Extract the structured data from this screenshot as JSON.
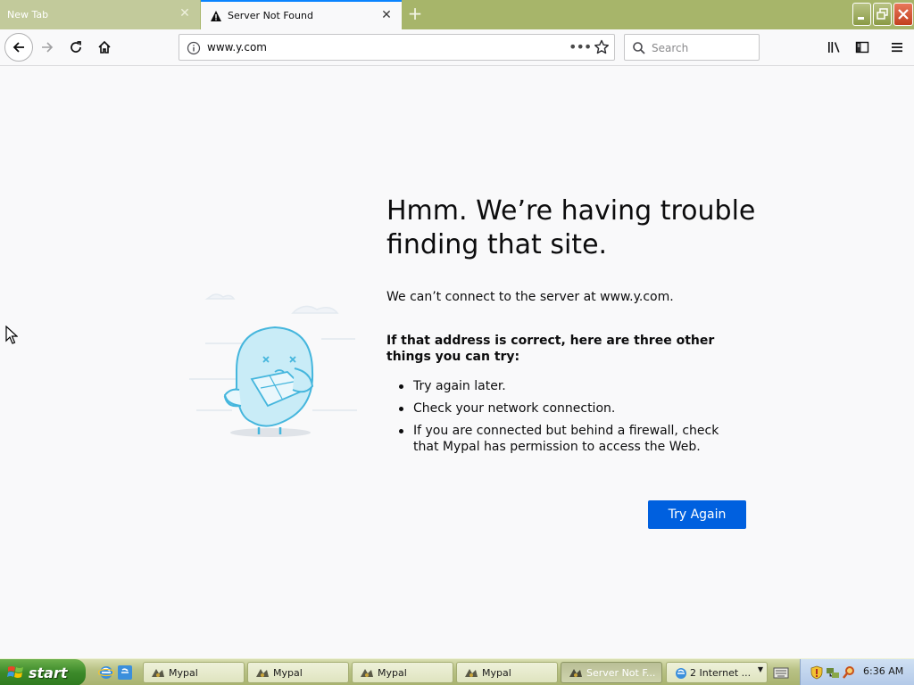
{
  "tabs": [
    {
      "title": "New Tab",
      "active": false
    },
    {
      "title": "Server Not Found",
      "active": true
    }
  ],
  "navbar": {
    "url": "www.y.com",
    "search_placeholder": "Search",
    "page_actions_label": "•••"
  },
  "error": {
    "title": "Hmm. We’re having trouble finding that site.",
    "description": "We can’t connect to the server at www.y.com.",
    "suggestions_heading": "If that address is correct, here are three other things you can try:",
    "suggestions": [
      "Try again later.",
      "Check your network connection.",
      "If you are connected but behind a firewall, check that Mypal has permission to access the Web."
    ],
    "button": "Try Again",
    "accent": "#0060df"
  },
  "taskbar": {
    "start_label": "start",
    "buttons": [
      {
        "label": "Mypal",
        "icon": "mypal-icon"
      },
      {
        "label": "Mypal",
        "icon": "mypal-icon"
      },
      {
        "label": "Mypal",
        "icon": "mypal-icon"
      },
      {
        "label": "Mypal",
        "icon": "mypal-icon"
      },
      {
        "label": "Server Not F...",
        "icon": "mypal-icon",
        "active": true
      },
      {
        "label": "2 Internet ...",
        "icon": "ie-icon"
      }
    ],
    "clock": "6:36 AM"
  }
}
